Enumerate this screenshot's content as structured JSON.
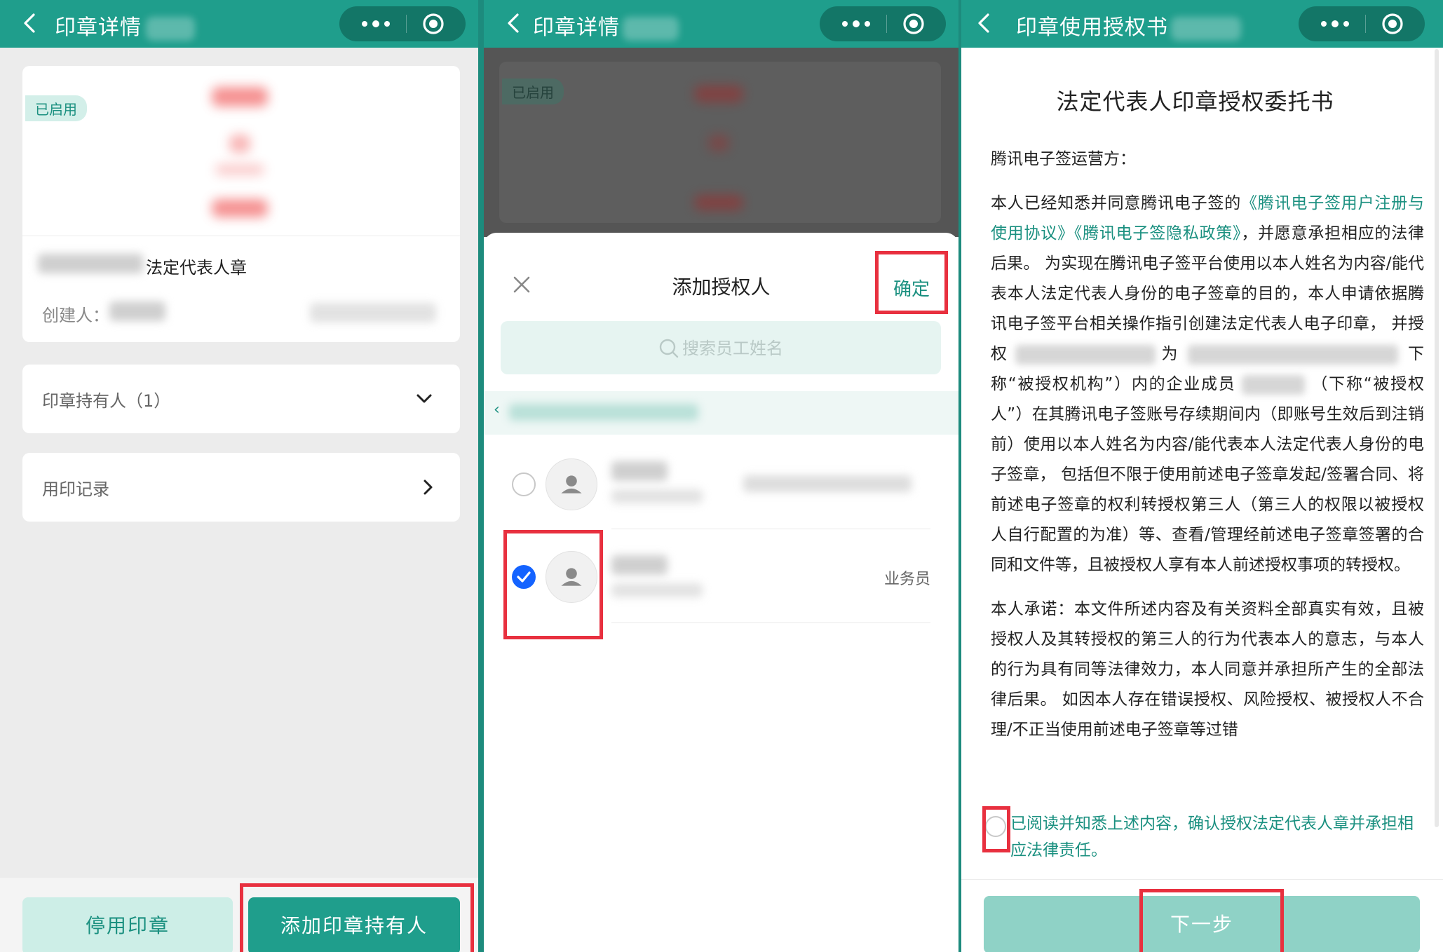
{
  "colors": {
    "brand": "#1f9e8c",
    "brand_dark": "#137667",
    "highlight": "#e8303f",
    "check": "#1463ff"
  },
  "panel1": {
    "title": "印章详情",
    "status_tag": "已启用",
    "seal_name_suffix": "法定代表人章",
    "creator_label": "创建人：",
    "holders_label": "印章持有人（1）",
    "records_label": "用印记录",
    "disable_button": "停用印章",
    "add_holder_button": "添加印章持有人"
  },
  "panel2": {
    "title": "印章详情",
    "status_tag": "已启用",
    "sheet_title": "添加授权人",
    "confirm_button": "确定",
    "search_placeholder": "搜索员工姓名",
    "members": [
      {
        "role": "",
        "selected": false
      },
      {
        "role": "业务员",
        "selected": true
      }
    ]
  },
  "panel3": {
    "title": "印章使用授权书",
    "doc_title": "法定代表人印章授权委托书",
    "addressee": "腾讯电子签运营方：",
    "p1_a": "本人已经知悉并同意腾讯电子签的",
    "p1_link1": "《腾讯电子签用户注册与使用协议》",
    "p1_link2": "《腾讯电子签隐私政策》",
    "p1_b": "，并愿意承担相应的法律后果。 为实现在腾讯电子签平台使用以本人姓名为内容/能代表本人法定代表人身份的电子签章的目的，本人申请依据腾讯电子签平台相关操作指引创建法定代表人电子印章， 并授权",
    "p1_c": "为",
    "p1_d": "下称“被授权机构”）内的企业成员",
    "p1_e": "（下称“被授权人”）在其腾讯电子签账号存续期间内（即账号生效后到注销前）使用以本人姓名为内容/能代表本人法定代表人身份的电子签章， 包括但不限于使用前述电子签章发起/签署合同、将前述电子签章的权利转授权第三人（第三人的权限以被授权人自行配置的为准）等、查看/管理经前述电子签章签署的合同和文件等，且被授权人享有本人前述授权事项的转授权。",
    "p2": "本人承诺：本文件所述内容及有关资料全部真实有效，且被授权人及其转授权的第三人的行为代表本人的意志，与本人的行为具有同等法律效力，本人同意并承担所产生的全部法律后果。 如因本人存在错误授权、风险授权、被授权人不合理/不正当使用前述电子签章等过错",
    "agree_text": "已阅读并知悉上述内容，确认授权法定代表人章并承担相应法律责任。",
    "next_button": "下一步"
  }
}
